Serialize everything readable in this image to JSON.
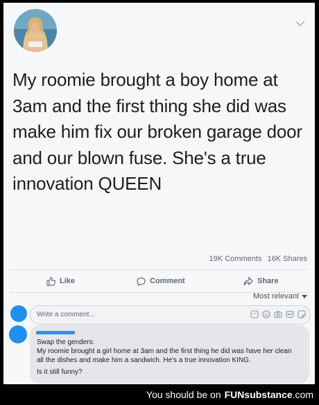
{
  "post": {
    "text": "My roomie brought a boy home at 3am and the first thing she did was make him fix our broken garage door and our blown fuse. She's a true innovation QUEEN",
    "stats": {
      "comments": "19K Comments",
      "shares": "16K Shares"
    }
  },
  "actions": {
    "like": "Like",
    "comment": "Comment",
    "share": "Share"
  },
  "sort": {
    "label": "Most relevant"
  },
  "comment_box": {
    "placeholder": "Write a comment..."
  },
  "reply": {
    "line1": "Swap the genders:",
    "line2": "My roomie brought a girl home at 3am and the first thing he did was have her clean all the dishes and make him a sandwich. He's a true innovation KING.",
    "line3": "Is it still funny?"
  },
  "watermark": {
    "prefix": "You should be on",
    "brand_fun": "FUN",
    "brand_sub": "substance",
    "brand_com": ".com"
  },
  "colors": {
    "accent": "#1f8ff0",
    "text": "#1c1e21",
    "muted": "#606770"
  }
}
